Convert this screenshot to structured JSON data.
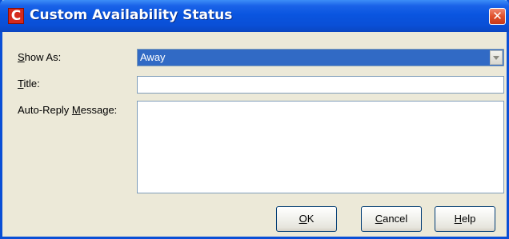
{
  "window": {
    "title": "Custom Availability Status",
    "app_icon_glyph": "C",
    "close_glyph": "✕"
  },
  "form": {
    "show_as": {
      "label_mnemonic": "S",
      "label_rest": "how As:",
      "selected_value": "Away"
    },
    "title": {
      "label_mnemonic": "T",
      "label_rest": "itle:",
      "value": ""
    },
    "auto_reply": {
      "label_before": "Auto-Reply ",
      "label_mnemonic": "M",
      "label_rest": "essage:",
      "value": ""
    }
  },
  "buttons": {
    "ok": {
      "mnemonic": "O",
      "rest": "K"
    },
    "cancel": {
      "mnemonic": "C",
      "rest": "ancel"
    },
    "help": {
      "mnemonic": "H",
      "rest": "elp"
    }
  },
  "colors": {
    "titlebar": "#0a4fd6",
    "dialog_bg": "#ece9d8",
    "selection": "#316ac5",
    "close_button": "#e0502b",
    "app_icon": "#d42a1d"
  },
  "icons": {
    "app": "app-logo-icon",
    "close": "close-icon",
    "dropdown": "chevron-down-icon"
  }
}
